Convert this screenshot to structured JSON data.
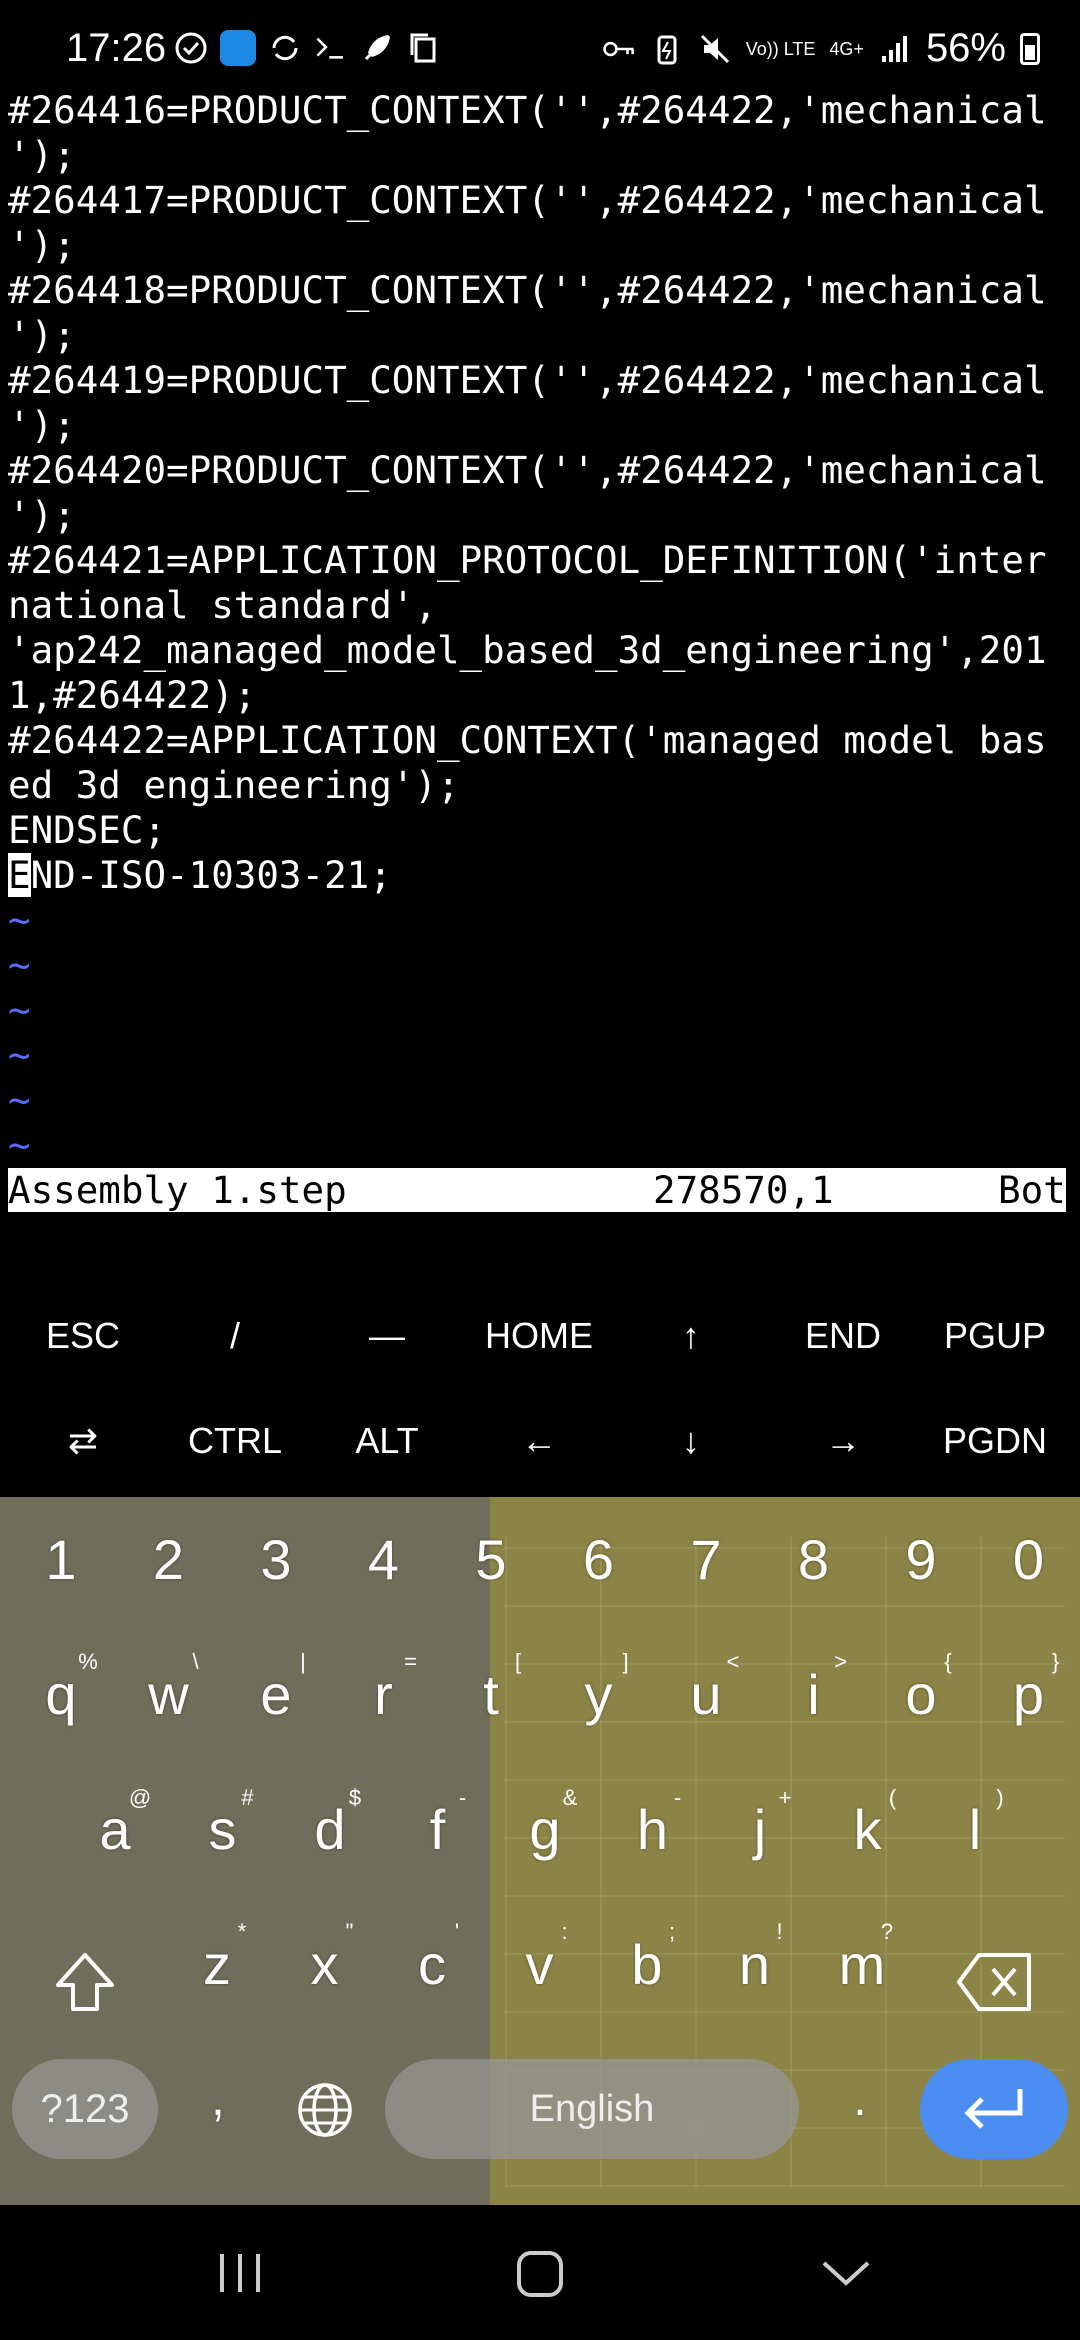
{
  "status_bar": {
    "time": "17:26",
    "net_label": "Vo)) LTE",
    "net_label2": "4G+",
    "battery": "56%"
  },
  "terminal": {
    "lines": [
      "#264416=PRODUCT_CONTEXT('',#264422,'mechanical",
      "');",
      "#264417=PRODUCT_CONTEXT('',#264422,'mechanical",
      "');",
      "#264418=PRODUCT_CONTEXT('',#264422,'mechanical",
      "');",
      "#264419=PRODUCT_CONTEXT('',#264422,'mechanical",
      "');",
      "#264420=PRODUCT_CONTEXT('',#264422,'mechanical",
      "');",
      "#264421=APPLICATION_PROTOCOL_DEFINITION('inter",
      "national standard',",
      "'ap242_managed_model_based_3d_engineering',201",
      "1,#264422);",
      "#264422=APPLICATION_CONTEXT('managed model bas",
      "ed 3d engineering');",
      "ENDSEC;"
    ],
    "cursor_line_char": "E",
    "cursor_line_rest": "ND-ISO-10303-21;",
    "tildes": [
      "~",
      "~",
      "~",
      "~",
      "~",
      "~"
    ]
  },
  "vim_status": {
    "filename": "Assembly 1.step",
    "position": "278570,1",
    "scroll": "Bot"
  },
  "extra_keys": {
    "row1": [
      "ESC",
      "/",
      "—",
      "HOME",
      "↑",
      "END",
      "PGUP"
    ],
    "row2": [
      "⇄",
      "CTRL",
      "ALT",
      "←",
      "↓",
      "→",
      "PGDN"
    ]
  },
  "keyboard": {
    "numbers": [
      "1",
      "2",
      "3",
      "4",
      "5",
      "6",
      "7",
      "8",
      "9",
      "0"
    ],
    "row_q": [
      "q",
      "w",
      "e",
      "r",
      "t",
      "y",
      "u",
      "i",
      "o",
      "p"
    ],
    "row_q_hints": [
      "%",
      "\\",
      "|",
      "=",
      "[",
      "]",
      "<",
      ">",
      "{",
      "}"
    ],
    "row_a": [
      "a",
      "s",
      "d",
      "f",
      "g",
      "h",
      "j",
      "k",
      "l"
    ],
    "row_a_hints": [
      "@",
      "#",
      "$",
      "-",
      "&",
      "-",
      "+",
      "(",
      ")"
    ],
    "row_z": [
      "z",
      "x",
      "c",
      "v",
      "b",
      "n",
      "m"
    ],
    "row_z_hints": [
      "*",
      "\"",
      "'",
      ":",
      ";",
      "!",
      "?"
    ],
    "symbols_label": "?123",
    "comma": ",",
    "space_label": "English",
    "period": "."
  },
  "colors": {
    "accent_enter": "#4a8cf0",
    "vim_tilde": "#5c6cff"
  }
}
